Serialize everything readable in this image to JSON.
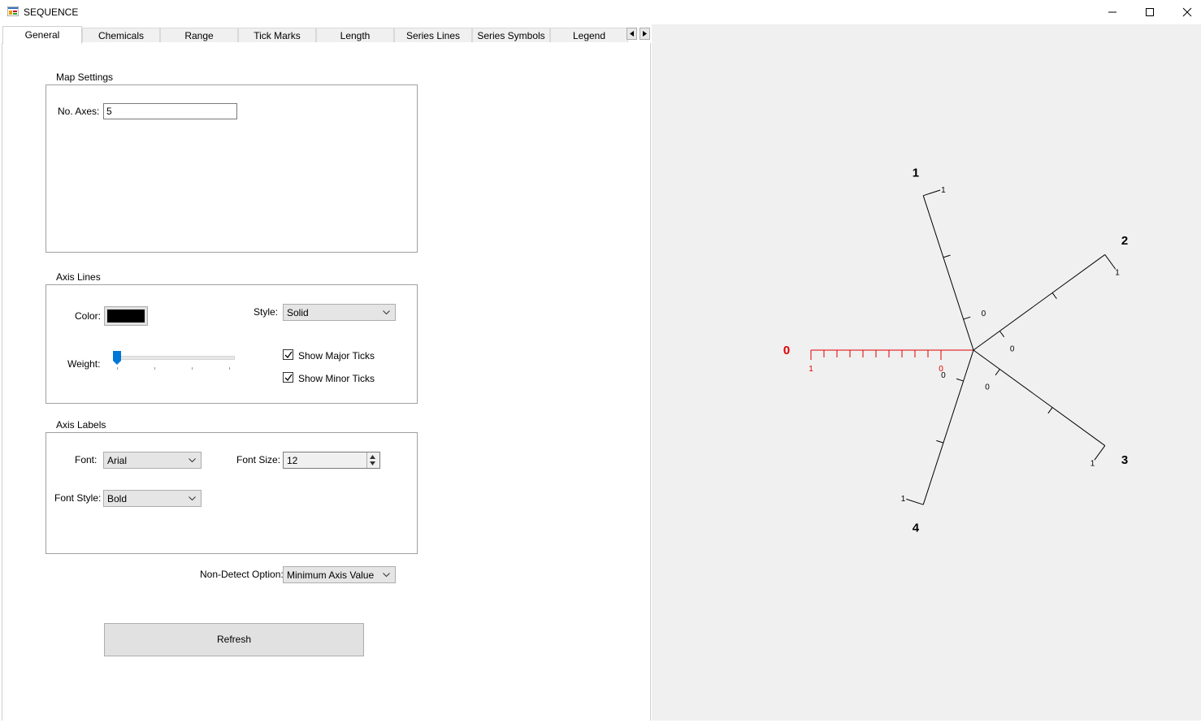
{
  "window": {
    "title": "SEQUENCE"
  },
  "tabs": {
    "items": [
      "General",
      "Chemicals",
      "Range",
      "Tick Marks",
      "Length",
      "Series Lines",
      "Series Symbols",
      "Legend"
    ],
    "active": "General"
  },
  "map_settings": {
    "title": "Map Settings",
    "no_axes_label": "No. Axes:",
    "no_axes_value": "5"
  },
  "axis_lines": {
    "title": "Axis Lines",
    "color_label": "Color:",
    "color_value": "#000000",
    "style_label": "Style:",
    "style_value": "Solid",
    "weight_label": "Weight:",
    "weight_slider_value": 0,
    "show_major_ticks_label": "Show Major Ticks",
    "show_major_ticks_checked": true,
    "show_minor_ticks_label": "Show Minor Ticks",
    "show_minor_ticks_checked": true
  },
  "axis_labels": {
    "title": "Axis Labels",
    "font_label": "Font:",
    "font_value": "Arial",
    "font_size_label": "Font Size:",
    "font_size_value": "12",
    "font_style_label": "Font Style:",
    "font_style_value": "Bold"
  },
  "non_detect": {
    "label": "Non-Detect Option:",
    "value": "Minimum Axis Value"
  },
  "refresh_label": "Refresh",
  "preview": {
    "highlight_color": "#e00000",
    "axes": [
      {
        "name": "0",
        "min_label": "0",
        "max_label": "1",
        "highlighted": true
      },
      {
        "name": "1",
        "min_label": "0",
        "max_label": "1",
        "highlighted": false
      },
      {
        "name": "2",
        "min_label": "0",
        "max_label": "1",
        "highlighted": false
      },
      {
        "name": "3",
        "min_label": "0",
        "max_label": "1",
        "highlighted": false
      },
      {
        "name": "4",
        "min_label": "0",
        "max_label": "1",
        "highlighted": false
      }
    ]
  }
}
